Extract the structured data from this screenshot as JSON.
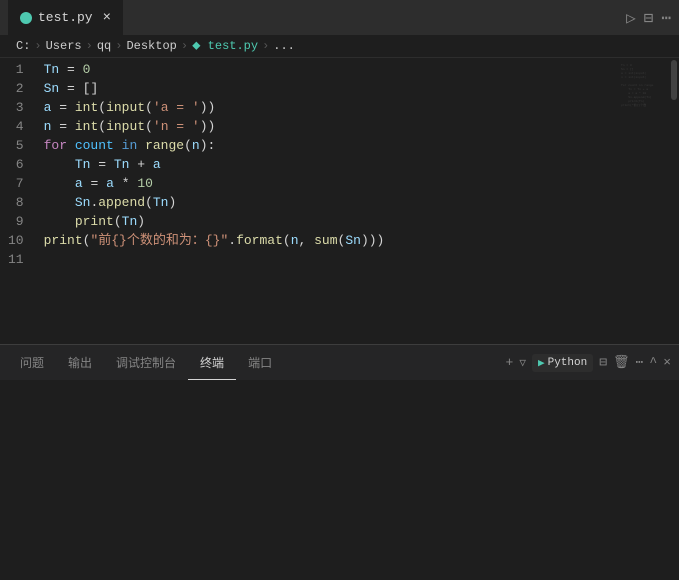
{
  "title_bar": {
    "tab_name": "test.py",
    "close_label": "×",
    "actions": [
      "▷",
      "⊟",
      "⋯"
    ]
  },
  "breadcrumb": {
    "items": [
      "C:",
      "Users",
      "qq",
      "Desktop",
      "test.py",
      "..."
    ]
  },
  "code": {
    "lines": [
      {
        "num": 1,
        "html": "<span class='var'>Tn</span> <span class='op'>=</span> <span class='num'>0</span>"
      },
      {
        "num": 2,
        "html": "<span class='var'>Sn</span> <span class='op'>=</span> <span class='punc'>[]</span>"
      },
      {
        "num": 3,
        "html": "<span class='var'>a</span> <span class='op'>=</span> <span class='builtin'>int</span><span class='punc'>(</span><span class='builtin'>input</span><span class='punc'>(</span><span class='str'>'a = '</span><span class='punc'>))</span>"
      },
      {
        "num": 4,
        "html": "<span class='var'>n</span> <span class='op'>=</span> <span class='builtin'>int</span><span class='punc'>(</span><span class='builtin'>input</span><span class='punc'>(</span><span class='str'>'n = '</span><span class='punc'>))</span>"
      },
      {
        "num": 5,
        "html": ""
      },
      {
        "num": 6,
        "html": "<span class='kw'>for</span> <span class='cn'>count</span> <span class='kw2'>in</span> <span class='builtin'>range</span><span class='punc'>(</span><span class='var'>n</span><span class='punc'>):</span>"
      },
      {
        "num": 7,
        "html": "    <span class='var'>Tn</span> <span class='op'>=</span> <span class='var'>Tn</span> <span class='op'>+</span> <span class='var'>a</span>"
      },
      {
        "num": 8,
        "html": "    <span class='var'>a</span> <span class='op'>=</span> <span class='var'>a</span> <span class='op'>*</span> <span class='num'>10</span>"
      },
      {
        "num": 9,
        "html": "    <span class='var'>Sn</span><span class='punc'>.</span><span class='builtin'>append</span><span class='punc'>(</span><span class='var'>Tn</span><span class='punc'>)</span>"
      },
      {
        "num": 10,
        "html": "    <span class='builtin'>print</span><span class='punc'>(</span><span class='var'>Tn</span><span class='punc'>)</span>"
      },
      {
        "num": 11,
        "html": "<span class='builtin'>print</span><span class='punc'>(</span><span class='str'>\"前{}个数的和为：{}\"</span><span class='punc'>.</span><span class='builtin'>format</span><span class='punc'>(</span><span class='var'>n</span><span class='punc'>,</span> <span class='builtin'>sum</span><span class='punc'>(</span><span class='var'>Sn</span><span class='punc'>)))</span>"
      }
    ]
  },
  "panel": {
    "tabs": [
      "问题",
      "输出",
      "调试控制台",
      "终端",
      "端口"
    ],
    "active_tab": "终端",
    "actions": [
      "+",
      "▽",
      "Python",
      "⊟",
      "🗑",
      "⋯",
      "^",
      "×"
    ]
  }
}
